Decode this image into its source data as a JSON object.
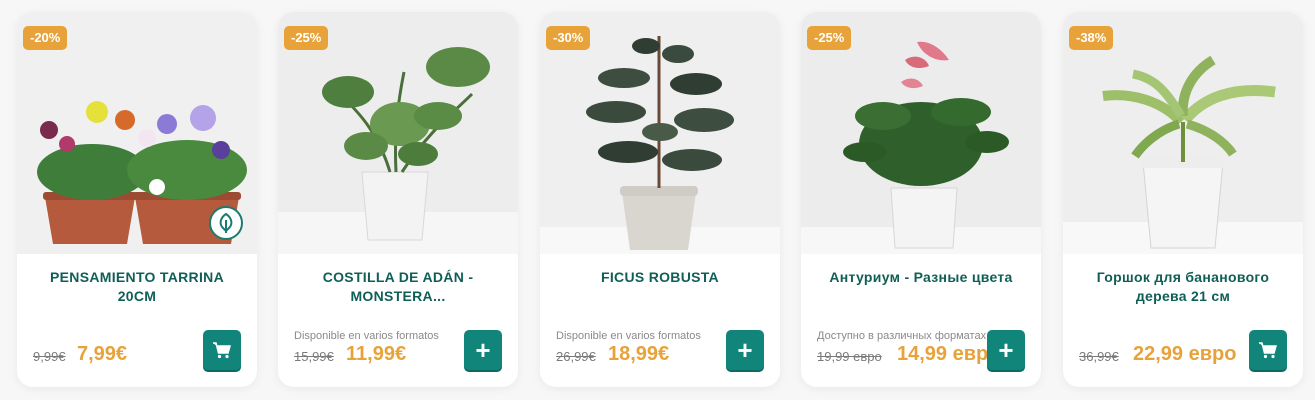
{
  "products": [
    {
      "discount": "-20%",
      "title_lines": [
        "PENSAMIENTO TARRINA",
        "20CM"
      ],
      "availability": "",
      "old_price": "9,99€",
      "price": "7,99€",
      "action": "cart",
      "eco_badge": true
    },
    {
      "discount": "-25%",
      "title_lines": [
        "COSTILLA DE ADÁN -",
        "MONSTERA..."
      ],
      "availability": "Disponible en varios formatos",
      "old_price": "15,99€",
      "price": "11,99€",
      "action": "plus",
      "plus_label": "+"
    },
    {
      "discount": "-30%",
      "title_lines": [
        "FICUS ROBUSTA",
        ""
      ],
      "availability": "Disponible en varios formatos",
      "old_price": "26,99€",
      "price": "18,99€",
      "action": "plus",
      "plus_label": "+"
    },
    {
      "discount": "-25%",
      "title_lines": [
        "Антуриум - Разные цвета",
        ""
      ],
      "availability": "Доступно в различных форматах",
      "old_price": "19,99 евро",
      "price": "14,99 евро",
      "action": "plus",
      "plus_label": "+"
    },
    {
      "discount": "-38%",
      "title_lines": [
        "Горшок для бананового",
        "дерева 21 см"
      ],
      "availability": "",
      "old_price": "36,99€",
      "price": "22,99 евро",
      "action": "cart"
    }
  ],
  "icons": {
    "cart": "shopping-cart-icon",
    "plus": "plus-icon",
    "eco": "eco-leaf-icon"
  },
  "colors": {
    "accent": "#e8a23a",
    "brand": "#12857a",
    "title": "#0f5f57"
  }
}
